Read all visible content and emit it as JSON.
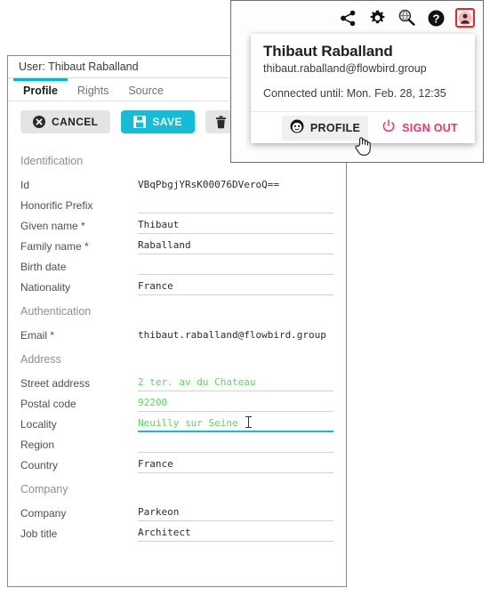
{
  "window": {
    "title": "User: Thibaut Raballand",
    "tabs": [
      {
        "label": "Profile",
        "active": true
      },
      {
        "label": "Rights",
        "active": false
      },
      {
        "label": "Source",
        "active": false
      }
    ],
    "actions": {
      "cancel_label": "CANCEL",
      "save_label": "SAVE",
      "delete_label": ""
    }
  },
  "form": {
    "sections": [
      {
        "title": "Identification",
        "fields": [
          {
            "label": "Id",
            "value": "VBqPbgjYRsK00076DVeroQ==",
            "state": "readonly"
          },
          {
            "label": "Honorific Prefix",
            "value": "",
            "state": "normal"
          },
          {
            "label": "Given name *",
            "value": "Thibaut",
            "state": "normal"
          },
          {
            "label": "Family name *",
            "value": "Raballand",
            "state": "normal"
          },
          {
            "label": "Birth date",
            "value": "",
            "state": "normal"
          },
          {
            "label": "Nationality",
            "value": "France",
            "state": "normal"
          }
        ]
      },
      {
        "title": "Authentication",
        "fields": [
          {
            "label": "Email *",
            "value": "thibaut.raballand@flowbird.group",
            "state": "readonly"
          }
        ]
      },
      {
        "title": "Address",
        "fields": [
          {
            "label": "Street address",
            "value": "2 ter. av du Chateau",
            "state": "modified"
          },
          {
            "label": "Postal code",
            "value": "92200",
            "state": "modified"
          },
          {
            "label": "Locality",
            "value": "Neuilly sur Seine",
            "state": "modified-focused"
          },
          {
            "label": "Region",
            "value": "",
            "state": "normal"
          },
          {
            "label": "Country",
            "value": "France",
            "state": "normal"
          }
        ]
      },
      {
        "title": "Company",
        "fields": [
          {
            "label": "Company",
            "value": "Parkeon",
            "state": "normal"
          },
          {
            "label": "Job title",
            "value": "Architect",
            "state": "normal"
          }
        ]
      }
    ]
  },
  "toolbar": {
    "icons": [
      {
        "name": "share-icon"
      },
      {
        "name": "gear-icon"
      },
      {
        "name": "search-globe-icon"
      },
      {
        "name": "help-icon"
      },
      {
        "name": "account-icon"
      }
    ]
  },
  "account_popup": {
    "name": "Thibaut Raballand",
    "email": "thibaut.raballand@flowbird.group",
    "connected_until": "Connected until: Mon. Feb. 28, 12:35",
    "profile_label": "PROFILE",
    "sign_out_label": "SIGN OUT"
  },
  "colors": {
    "accent_cyan": "#15bcd6",
    "signout_pink": "#f7336c",
    "modified_green": "#5fd45f",
    "highlight_red": "#ff1f1f"
  }
}
